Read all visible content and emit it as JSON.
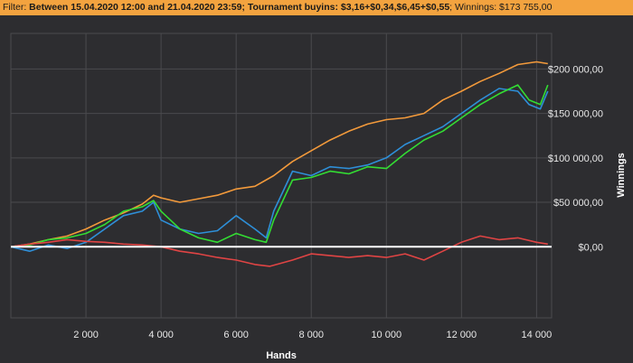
{
  "filter": {
    "label": "Filter:",
    "text": "Between 15.04.2020 12:00 and 21.04.2020 23:59; Tournament buyins: $3,16+$0,34,$6,45+$0,55",
    "winnings_label": "Winnings:",
    "winnings_value": "$173 755,00"
  },
  "chart_data": {
    "type": "line",
    "xlabel": "Hands",
    "ylabel": "Winnings",
    "xlim": [
      0,
      14400
    ],
    "ylim": [
      -80000,
      240000
    ],
    "x_ticks": [
      2000,
      4000,
      6000,
      8000,
      10000,
      12000,
      14000
    ],
    "x_tick_labels": [
      "2 000",
      "4 000",
      "6 000",
      "8 000",
      "10 000",
      "12 000",
      "14 000"
    ],
    "y_ticks": [
      0,
      50000,
      100000,
      150000,
      200000
    ],
    "y_tick_labels": [
      "$0,00",
      "$50 000,00",
      "$100 000,00",
      "$150 000,00",
      "$200 000,00"
    ],
    "grid": true,
    "y_axis_side": "right",
    "colors": {
      "background": "#2d2d30",
      "grid": "#4a4a4e",
      "zero_line": "#ffffff"
    },
    "series": [
      {
        "color": "#f39a3b",
        "x": [
          0,
          500,
          1000,
          1500,
          2000,
          2500,
          3000,
          3500,
          3800,
          4000,
          4500,
          5000,
          5500,
          6000,
          6500,
          7000,
          7500,
          8000,
          8500,
          9000,
          9500,
          10000,
          10500,
          11000,
          11500,
          12000,
          12500,
          13000,
          13500,
          14000,
          14300
        ],
        "y": [
          0,
          3000,
          8000,
          12000,
          20000,
          30000,
          38000,
          48000,
          58000,
          55000,
          50000,
          54000,
          58000,
          65000,
          68000,
          80000,
          96000,
          108000,
          120000,
          130000,
          138000,
          143000,
          145000,
          150000,
          165000,
          175000,
          186000,
          195000,
          205000,
          208000,
          206000
        ]
      },
      {
        "color": "#2e8fd8",
        "x": [
          0,
          500,
          1000,
          1500,
          2000,
          2500,
          3000,
          3500,
          3800,
          4000,
          4500,
          5000,
          5500,
          6000,
          6500,
          6800,
          7000,
          7500,
          8000,
          8500,
          9000,
          9500,
          10000,
          10500,
          11000,
          11500,
          12000,
          12500,
          13000,
          13500,
          13800,
          14100,
          14300
        ],
        "y": [
          0,
          -5000,
          2000,
          -2000,
          5000,
          20000,
          35000,
          40000,
          50000,
          30000,
          20000,
          15000,
          18000,
          35000,
          20000,
          10000,
          40000,
          85000,
          80000,
          90000,
          88000,
          92000,
          100000,
          115000,
          125000,
          135000,
          150000,
          165000,
          178000,
          175000,
          160000,
          155000,
          175000
        ]
      },
      {
        "color": "#33dd33",
        "x": [
          0,
          500,
          1000,
          1500,
          2000,
          2500,
          3000,
          3500,
          3800,
          4000,
          4500,
          5000,
          5500,
          6000,
          6500,
          6800,
          7000,
          7500,
          8000,
          8500,
          9000,
          9500,
          10000,
          10500,
          11000,
          11500,
          12000,
          12500,
          13000,
          13500,
          13800,
          14100,
          14300
        ],
        "y": [
          0,
          2000,
          8000,
          10000,
          15000,
          25000,
          40000,
          45000,
          52000,
          40000,
          20000,
          10000,
          5000,
          15000,
          8000,
          5000,
          30000,
          75000,
          78000,
          85000,
          82000,
          90000,
          88000,
          105000,
          120000,
          130000,
          145000,
          160000,
          172000,
          182000,
          165000,
          160000,
          182000
        ]
      },
      {
        "color": "#e04444",
        "x": [
          0,
          500,
          1000,
          1500,
          2000,
          2500,
          3000,
          3500,
          4000,
          4500,
          5000,
          5500,
          6000,
          6500,
          6900,
          7500,
          8000,
          8500,
          9000,
          9500,
          10000,
          10500,
          11000,
          11500,
          12000,
          12500,
          13000,
          13500,
          14000,
          14300
        ],
        "y": [
          0,
          3000,
          5000,
          8000,
          6000,
          5000,
          3000,
          2000,
          0,
          -5000,
          -8000,
          -12000,
          -15000,
          -20000,
          -22000,
          -15000,
          -8000,
          -10000,
          -12000,
          -10000,
          -12000,
          -8000,
          -15000,
          -5000,
          5000,
          12000,
          8000,
          10000,
          5000,
          3000
        ]
      }
    ]
  }
}
